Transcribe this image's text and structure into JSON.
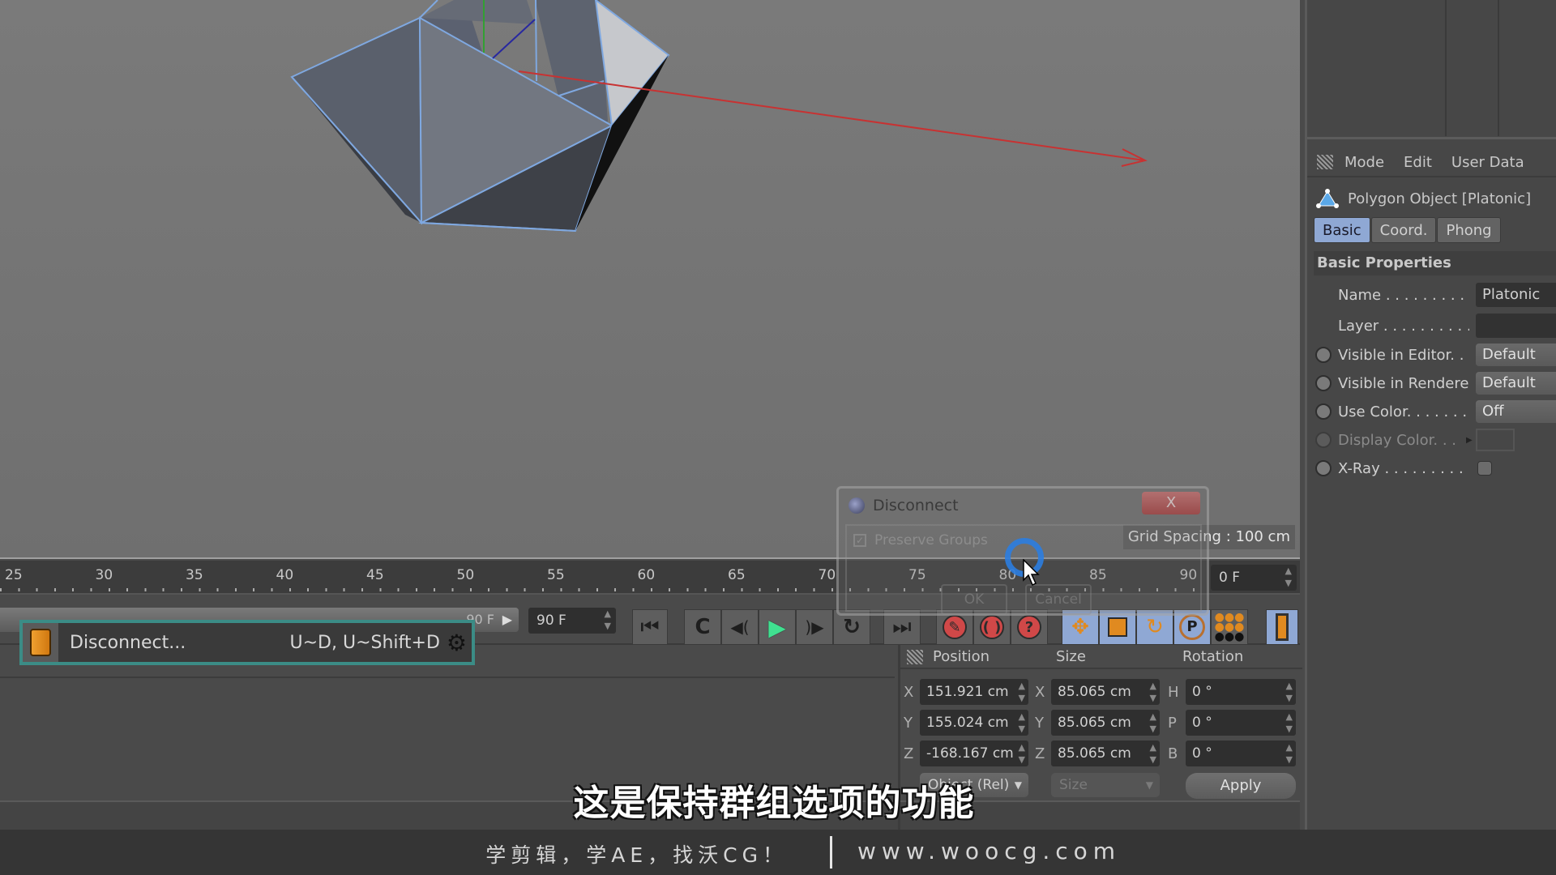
{
  "viewport": {
    "grid_spacing": "Grid Spacing : 100 cm",
    "axis_colors": {
      "x": "#c83232",
      "y": "#32a032",
      "z": "#2828a0"
    },
    "wire_color": "#7fa8e0"
  },
  "attributes": {
    "menu": [
      "Mode",
      "Edit",
      "User Data"
    ],
    "object_title": "Polygon Object [Platonic]",
    "tabs": [
      {
        "label": "Basic",
        "active": true
      },
      {
        "label": "Coord.",
        "active": false
      },
      {
        "label": "Phong",
        "active": false
      }
    ],
    "section": "Basic Properties",
    "props": {
      "name": {
        "label": "Name . . . . . . . . . . .",
        "value": "Platonic"
      },
      "layer": {
        "label": "Layer . . . . . . . . . . .",
        "value": ""
      },
      "visible_editor": {
        "label": "Visible in Editor. . .",
        "value": "Default"
      },
      "visible_renderer": {
        "label": "Visible in Renderer",
        "value": "Default"
      },
      "use_color": {
        "label": "Use Color. . . . . . . .",
        "value": "Off"
      },
      "display_color": {
        "label": "Display Color. . ."
      },
      "xray": {
        "label": "X-Ray . . . . . . . . . . .",
        "checked": false
      }
    }
  },
  "timeline": {
    "ticks": [
      "25",
      "30",
      "35",
      "40",
      "45",
      "50",
      "55",
      "60",
      "65",
      "70",
      "75",
      "80",
      "85",
      "90"
    ],
    "current_frame": "0 F",
    "range_end_label": "90 F",
    "end_frame": "90 F"
  },
  "command_popup": {
    "label": "Disconnect...",
    "shortcut": "U~D, U~Shift+D"
  },
  "dialog": {
    "title": "Disconnect",
    "close": "X",
    "option": "Preserve Groups",
    "option_checked": true,
    "ok": "OK",
    "cancel": "Cancel"
  },
  "coordinates": {
    "headers": {
      "position": "Position",
      "size": "Size",
      "rotation": "Rotation"
    },
    "position": [
      {
        "axis": "X",
        "value": "151.921 cm"
      },
      {
        "axis": "Y",
        "value": "155.024 cm"
      },
      {
        "axis": "Z",
        "value": "-168.167 cm"
      }
    ],
    "size": [
      {
        "axis": "X",
        "value": "85.065 cm"
      },
      {
        "axis": "Y",
        "value": "85.065 cm"
      },
      {
        "axis": "Z",
        "value": "85.065 cm"
      }
    ],
    "rotation": [
      {
        "axis": "H",
        "value": "0 °"
      },
      {
        "axis": "P",
        "value": "0 °"
      },
      {
        "axis": "B",
        "value": "0 °"
      }
    ],
    "mode_select": "Object (Rel)",
    "size_select": "Size",
    "apply": "Apply"
  },
  "subtitle": "这是保持群组选项的功能",
  "footer": {
    "left": "学剪辑，学AE，找沃CG！",
    "right": "www.woocg.com"
  }
}
